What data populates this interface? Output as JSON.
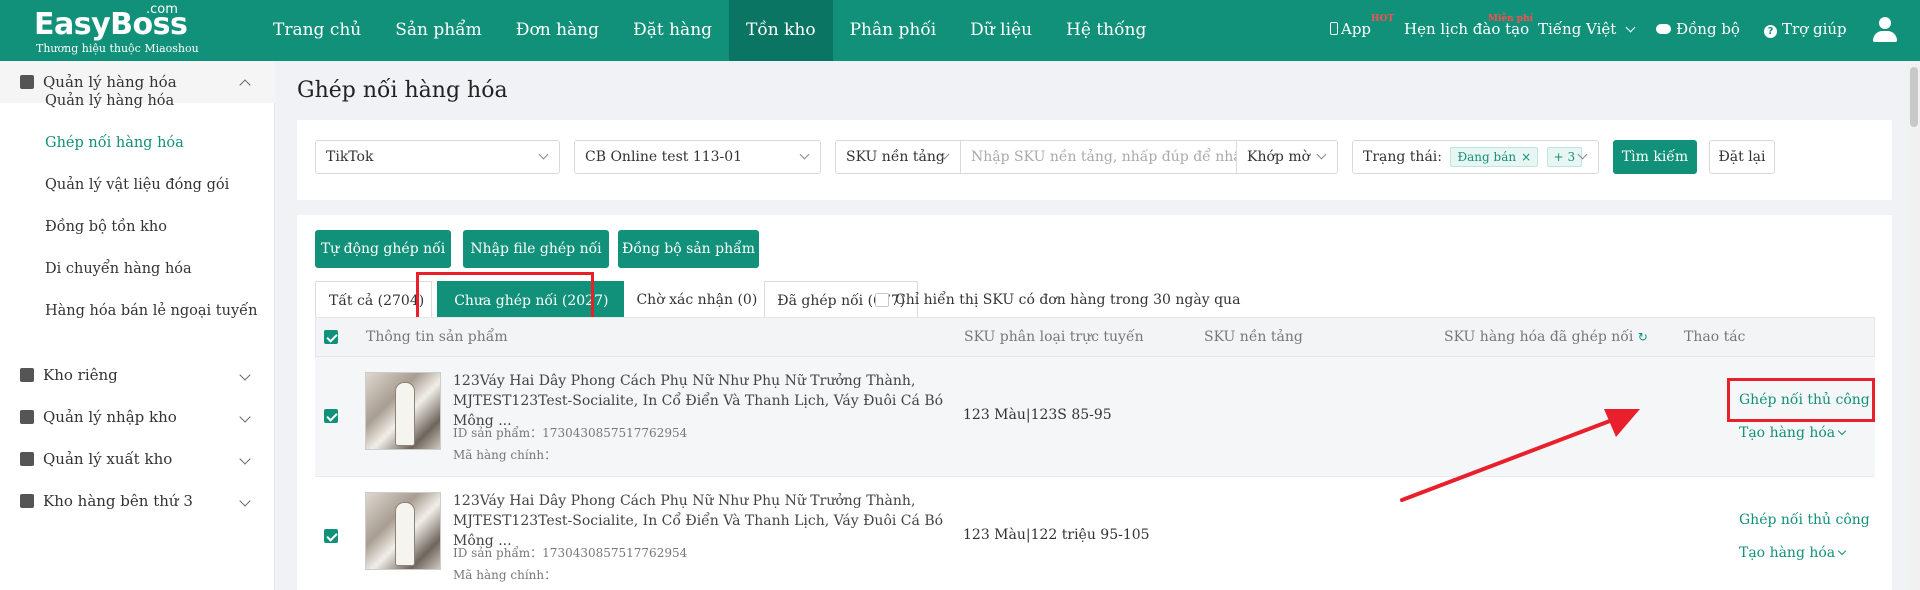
{
  "topbar": {
    "logo": "EasyBoss",
    "logo_com": ".com",
    "logo_sub": "Thương hiệu thuộc Miaoshou",
    "nav": [
      "Trang chủ",
      "Sản phẩm",
      "Đơn hàng",
      "Đặt hàng",
      "Tồn kho",
      "Phân phối",
      "Dữ liệu",
      "Hệ thống"
    ],
    "active_nav": "Tồn kho",
    "app": "App",
    "app_badge": "HOT",
    "training": "Hẹn lịch đào tạo",
    "training_badge": "Miễn phí",
    "language": "Tiếng Việt",
    "sync": "Đồng bộ",
    "help": "Trợ giúp"
  },
  "sidebar": {
    "groups": [
      {
        "label": "Quản lý hàng hóa",
        "open": true,
        "items": [
          "Quản lý hàng hóa",
          "Ghép nối hàng hóa",
          "Quản lý vật liệu đóng gói",
          "Đồng bộ tồn kho",
          "Di chuyển hàng hóa",
          "Hàng hóa bán lẻ ngoại tuyến"
        ]
      },
      {
        "label": "Kho riêng"
      },
      {
        "label": "Quản lý nhập kho"
      },
      {
        "label": "Quản lý xuất kho"
      },
      {
        "label": "Kho hàng bên thứ 3"
      }
    ],
    "active_item": "Ghép nối hàng hóa"
  },
  "page": {
    "title": "Ghép nối hàng hóa"
  },
  "filters": {
    "platform": "TikTok",
    "store": "CB Online test 113-01",
    "sku_type": "SKU nền tảng",
    "sku_placeholder": "Nhập SKU nền tảng, nhấp đúp để nhập tì",
    "match_mode": "Khớp mờ",
    "status_label": "Trạng thái:",
    "status_tag": "Đang bán",
    "status_more": "+ 3",
    "search_button": "Tìm kiếm",
    "reset_button": "Đặt lại"
  },
  "actions": {
    "auto_match": "Tự động ghép nối",
    "import_file": "Nhập file ghép nối",
    "sync_products": "Đồng bộ sản phẩm"
  },
  "tabs": [
    {
      "label": "Tất cả (2704)"
    },
    {
      "label": "Chưa ghép nối (2027)",
      "active": true
    },
    {
      "label": "Chờ xác nhận (0)"
    },
    {
      "label": "Đã ghép nối (677)"
    }
  ],
  "only_30_days": "Chỉ hiển thị SKU có đơn hàng trong 30 ngày qua",
  "table": {
    "columns": [
      "Thông tin sản phẩm",
      "SKU phân loại trực tuyến",
      "SKU nền tảng",
      "SKU hàng hóa đã ghép nối",
      "Thao tác"
    ],
    "rows": [
      {
        "title": "123Váy Hai Dây Phong Cách Phụ Nữ Như Phụ Nữ Trưởng Thành, MJTEST123Test-Socialite, In Cổ Điển Và Thanh Lịch, Váy Đuôi Cá Bó Mông ...",
        "product_id": "ID sản phẩm：1730430857517762954",
        "main_code": "Mã hàng chính：",
        "online_sku": "123 Màu|123S 85-95",
        "manual_match": "Ghép nối thủ công",
        "create_goods": "Tạo hàng hóa"
      },
      {
        "title": "123Váy Hai Dây Phong Cách Phụ Nữ Như Phụ Nữ Trưởng Thành, MJTEST123Test-Socialite, In Cổ Điển Và Thanh Lịch, Váy Đuôi Cá Bó Mông ...",
        "product_id": "ID sản phẩm：1730430857517762954",
        "main_code": "Mã hàng chính：",
        "online_sku": "123 Màu|122 triệu 95-105",
        "manual_match": "Ghép nối thủ công",
        "create_goods": "Tạo hàng hóa"
      }
    ]
  },
  "colors": {
    "brand": "#12917a",
    "highlight": "#e8202b"
  }
}
